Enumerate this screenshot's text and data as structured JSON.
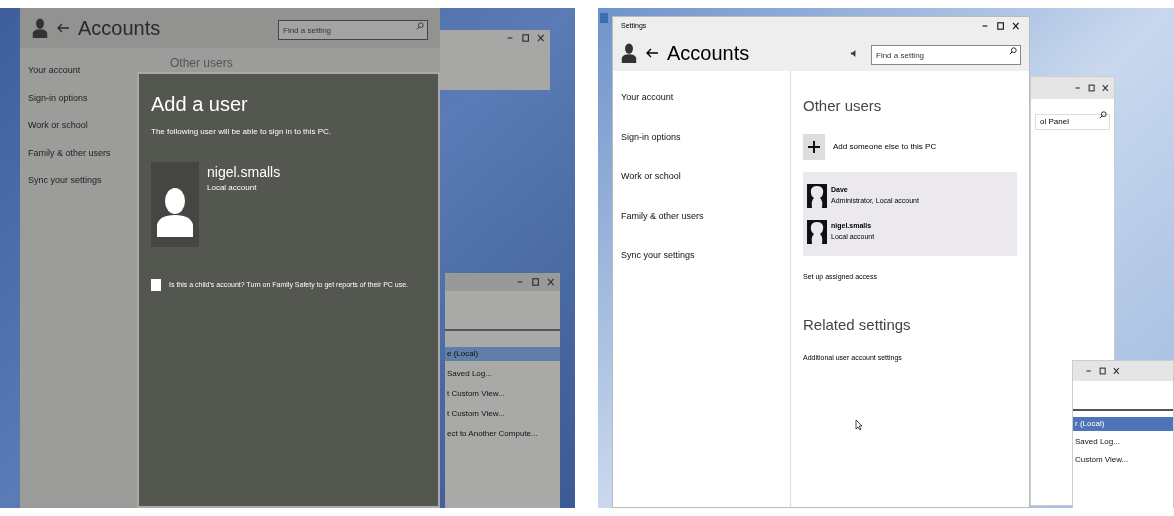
{
  "left_screen": {
    "settings_window": {
      "title": "Accounts",
      "search": {
        "placeholder": "Find a setting"
      },
      "nav": [
        "Your account",
        "Sign-in options",
        "Work or school",
        "Family & other users",
        "Sync your settings"
      ],
      "section_title": "Other users"
    },
    "dialog": {
      "title": "Add a user",
      "subtitle": "The following user will be able to sign in to this PC.",
      "user": {
        "name": "nigel.smalls",
        "type": "Local account"
      },
      "checkbox": {
        "label": "Is this a child's account? Turn on Family Safety to get reports of their PC use.",
        "checked": false
      }
    },
    "back_window": {
      "items": [
        {
          "label": "e (Local)",
          "selected": true
        },
        {
          "label": "Saved Log...",
          "selected": false
        },
        {
          "label": "t Custom View...",
          "selected": false
        },
        {
          "label": "t Custom View...",
          "selected": false
        },
        {
          "label": "ect to Another Compute...",
          "selected": false
        }
      ]
    }
  },
  "right_screen": {
    "settings_window": {
      "window_title": "Settings",
      "title": "Accounts",
      "search": {
        "placeholder": "Find a setting"
      },
      "nav": [
        "Your account",
        "Sign-in options",
        "Work or school",
        "Family & other users",
        "Sync your settings"
      ],
      "section_title": "Other users",
      "add_label": "Add someone else to this PC",
      "users": [
        {
          "name": "Dave",
          "type": "Administrator, Local account"
        },
        {
          "name": "nigel.smalls",
          "type": "Local account"
        }
      ],
      "assigned_access": "Set up assigned access",
      "related_title": "Related settings",
      "related_link": "Additional user account settings"
    },
    "back_window": {
      "search": {
        "value": "ol Panel"
      }
    },
    "lower_window": {
      "items": [
        {
          "label": "r (Local)",
          "selected": true
        },
        {
          "label": "Saved Log...",
          "selected": false
        },
        {
          "label": "Custom View...",
          "selected": false
        }
      ]
    }
  }
}
